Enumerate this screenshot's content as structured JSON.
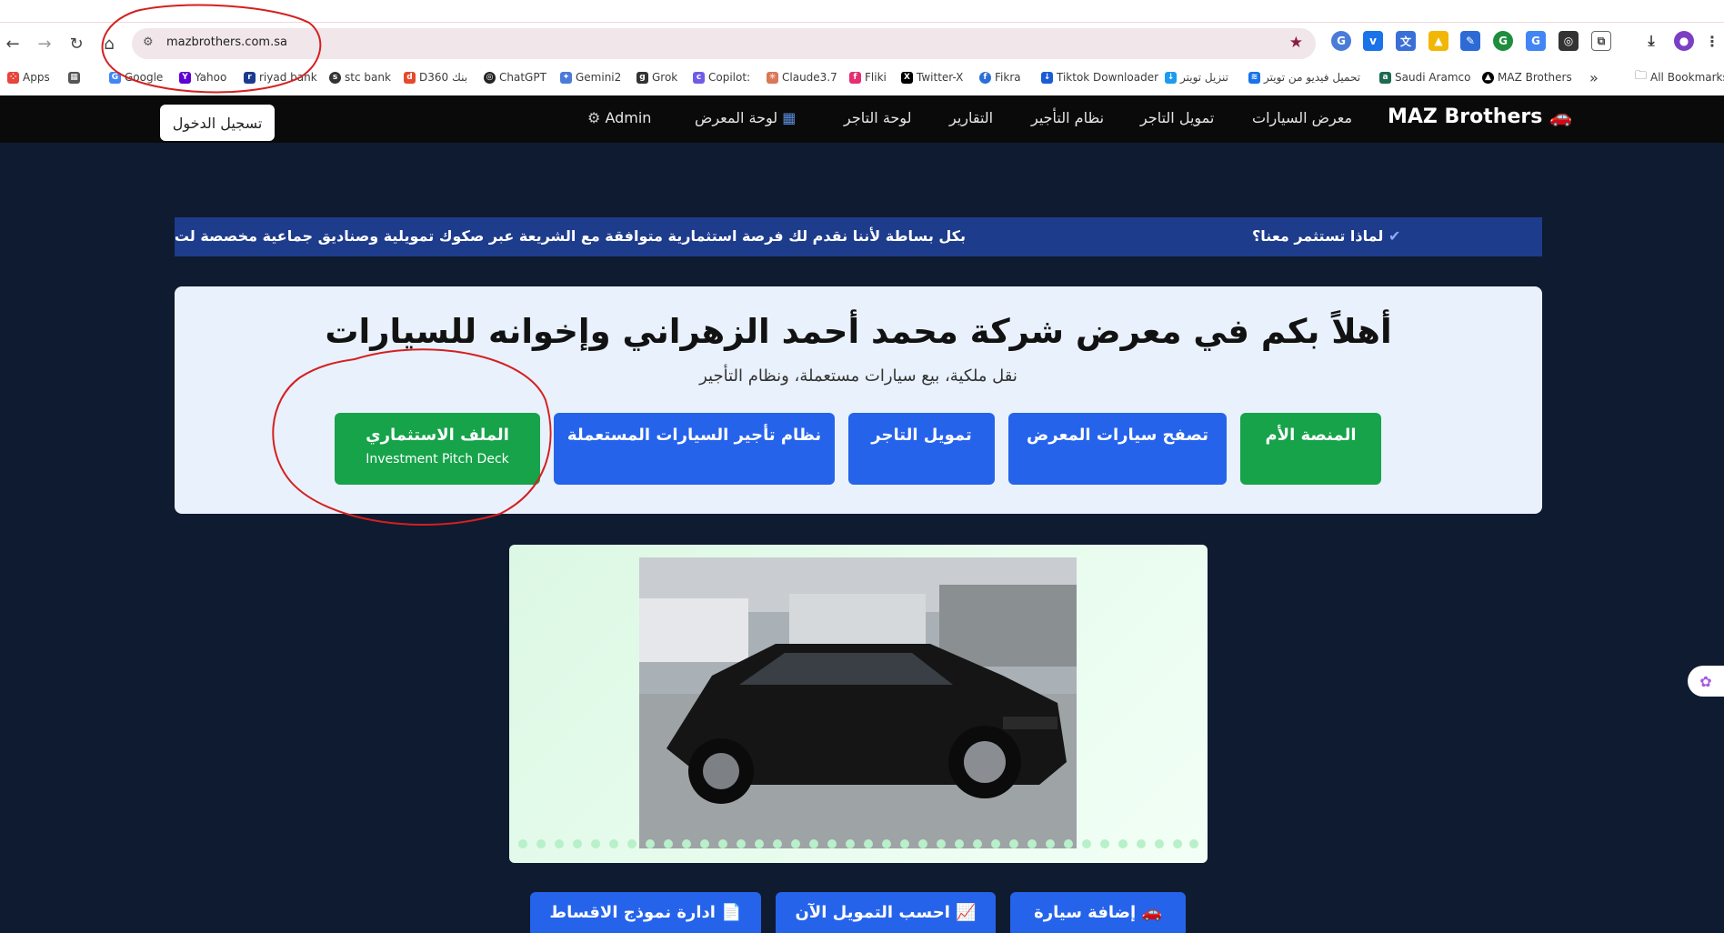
{
  "browser": {
    "url": "mazbrothers.com.sa",
    "bookmarks": [
      "Apps",
      "Google",
      "Yahoo",
      "riyad bank",
      "stc bank",
      "D360 بنك",
      "ChatGPT",
      "Gemini2",
      "Grok",
      "Copilot:",
      "Claude3.7",
      "Fliki",
      "Twitter-X",
      "Fikra",
      "Tiktok Downloader",
      "تنزيل تويتر",
      "تحميل فيديو من تويتر",
      "Saudi Aramco",
      "MAZ Brothers",
      "All Bookmarks"
    ],
    "overflow": "»"
  },
  "nav": {
    "brand": "MAZ Brothers",
    "links": [
      "معرض السيارات",
      "تمويل التاجر",
      "نظام التأجير",
      "التقارير",
      "لوحة التاجر",
      "لوحة المعرض",
      "Admin"
    ],
    "login": "تسجيل الدخول"
  },
  "ticker": {
    "question": "لماذا تستثمر معنا؟",
    "text": "بكل بساطة لأننا نقدم لك فرصة استثمارية متوافقة مع الشريعة عبر صكوك تمويلية وصناديق جماعية مخصصة لت"
  },
  "hero": {
    "title": "أهلاً بكم في معرض شركة محمد أحمد الزهراني وإخوانه للسيارات",
    "subtitle": "نقل ملكية، بيع سيارات مستعملة، ونظام التأجير",
    "buttons": [
      "المنصة الأم",
      "تصفح سيارات المعرض",
      "تمويل التاجر",
      "نظام تأجير السيارات المستعملة",
      "الملف الاستثماري"
    ],
    "pitch_sub": "Investment Pitch Deck"
  },
  "actions": [
    "إضافة سيارة",
    "احسب التمويل الآن",
    "ادارة نموذج الاقساط"
  ],
  "colors": {
    "primary": "#2563eb",
    "green": "#16a34a",
    "navbar": "#0a0a0a",
    "page_bg": "#0f1b30",
    "ticker": "#1e3c8c",
    "annotation": "#d42020"
  }
}
